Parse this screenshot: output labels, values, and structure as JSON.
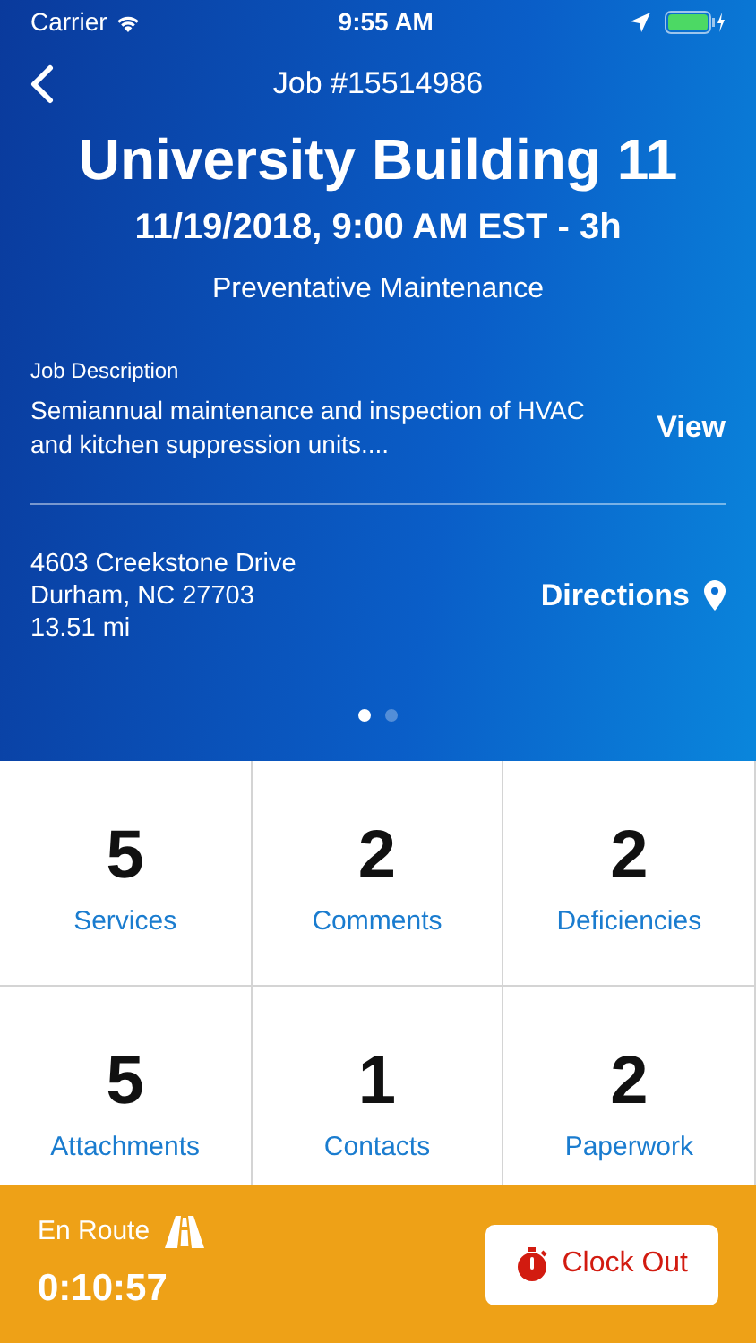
{
  "status_bar": {
    "carrier": "Carrier",
    "time": "9:55 AM"
  },
  "header": {
    "title": "Job #15514986"
  },
  "job": {
    "name": "University Building 11",
    "schedule": "11/19/2018, 9:00 AM EST - 3h",
    "type": "Preventative Maintenance",
    "description_label": "Job Description",
    "description": "Semiannual maintenance and inspection of HVAC and kitchen suppression units....",
    "view": "View",
    "address": [
      "4603 Creekstone Drive",
      "Durham, NC 27703",
      "13.51 mi"
    ],
    "directions": "Directions"
  },
  "pages": [
    {
      "selected": true
    },
    {
      "selected": false
    }
  ],
  "tiles": [
    {
      "count": "5",
      "label": "Services"
    },
    {
      "count": "2",
      "label": "Comments"
    },
    {
      "count": "2",
      "label": "Deficiencies"
    },
    {
      "count": "5",
      "label": "Attachments"
    },
    {
      "count": "1",
      "label": "Contacts"
    },
    {
      "count": "2",
      "label": "Paperwork"
    }
  ],
  "footer": {
    "status": "En Route",
    "timer": "0:10:57",
    "button": "Clock Out"
  }
}
